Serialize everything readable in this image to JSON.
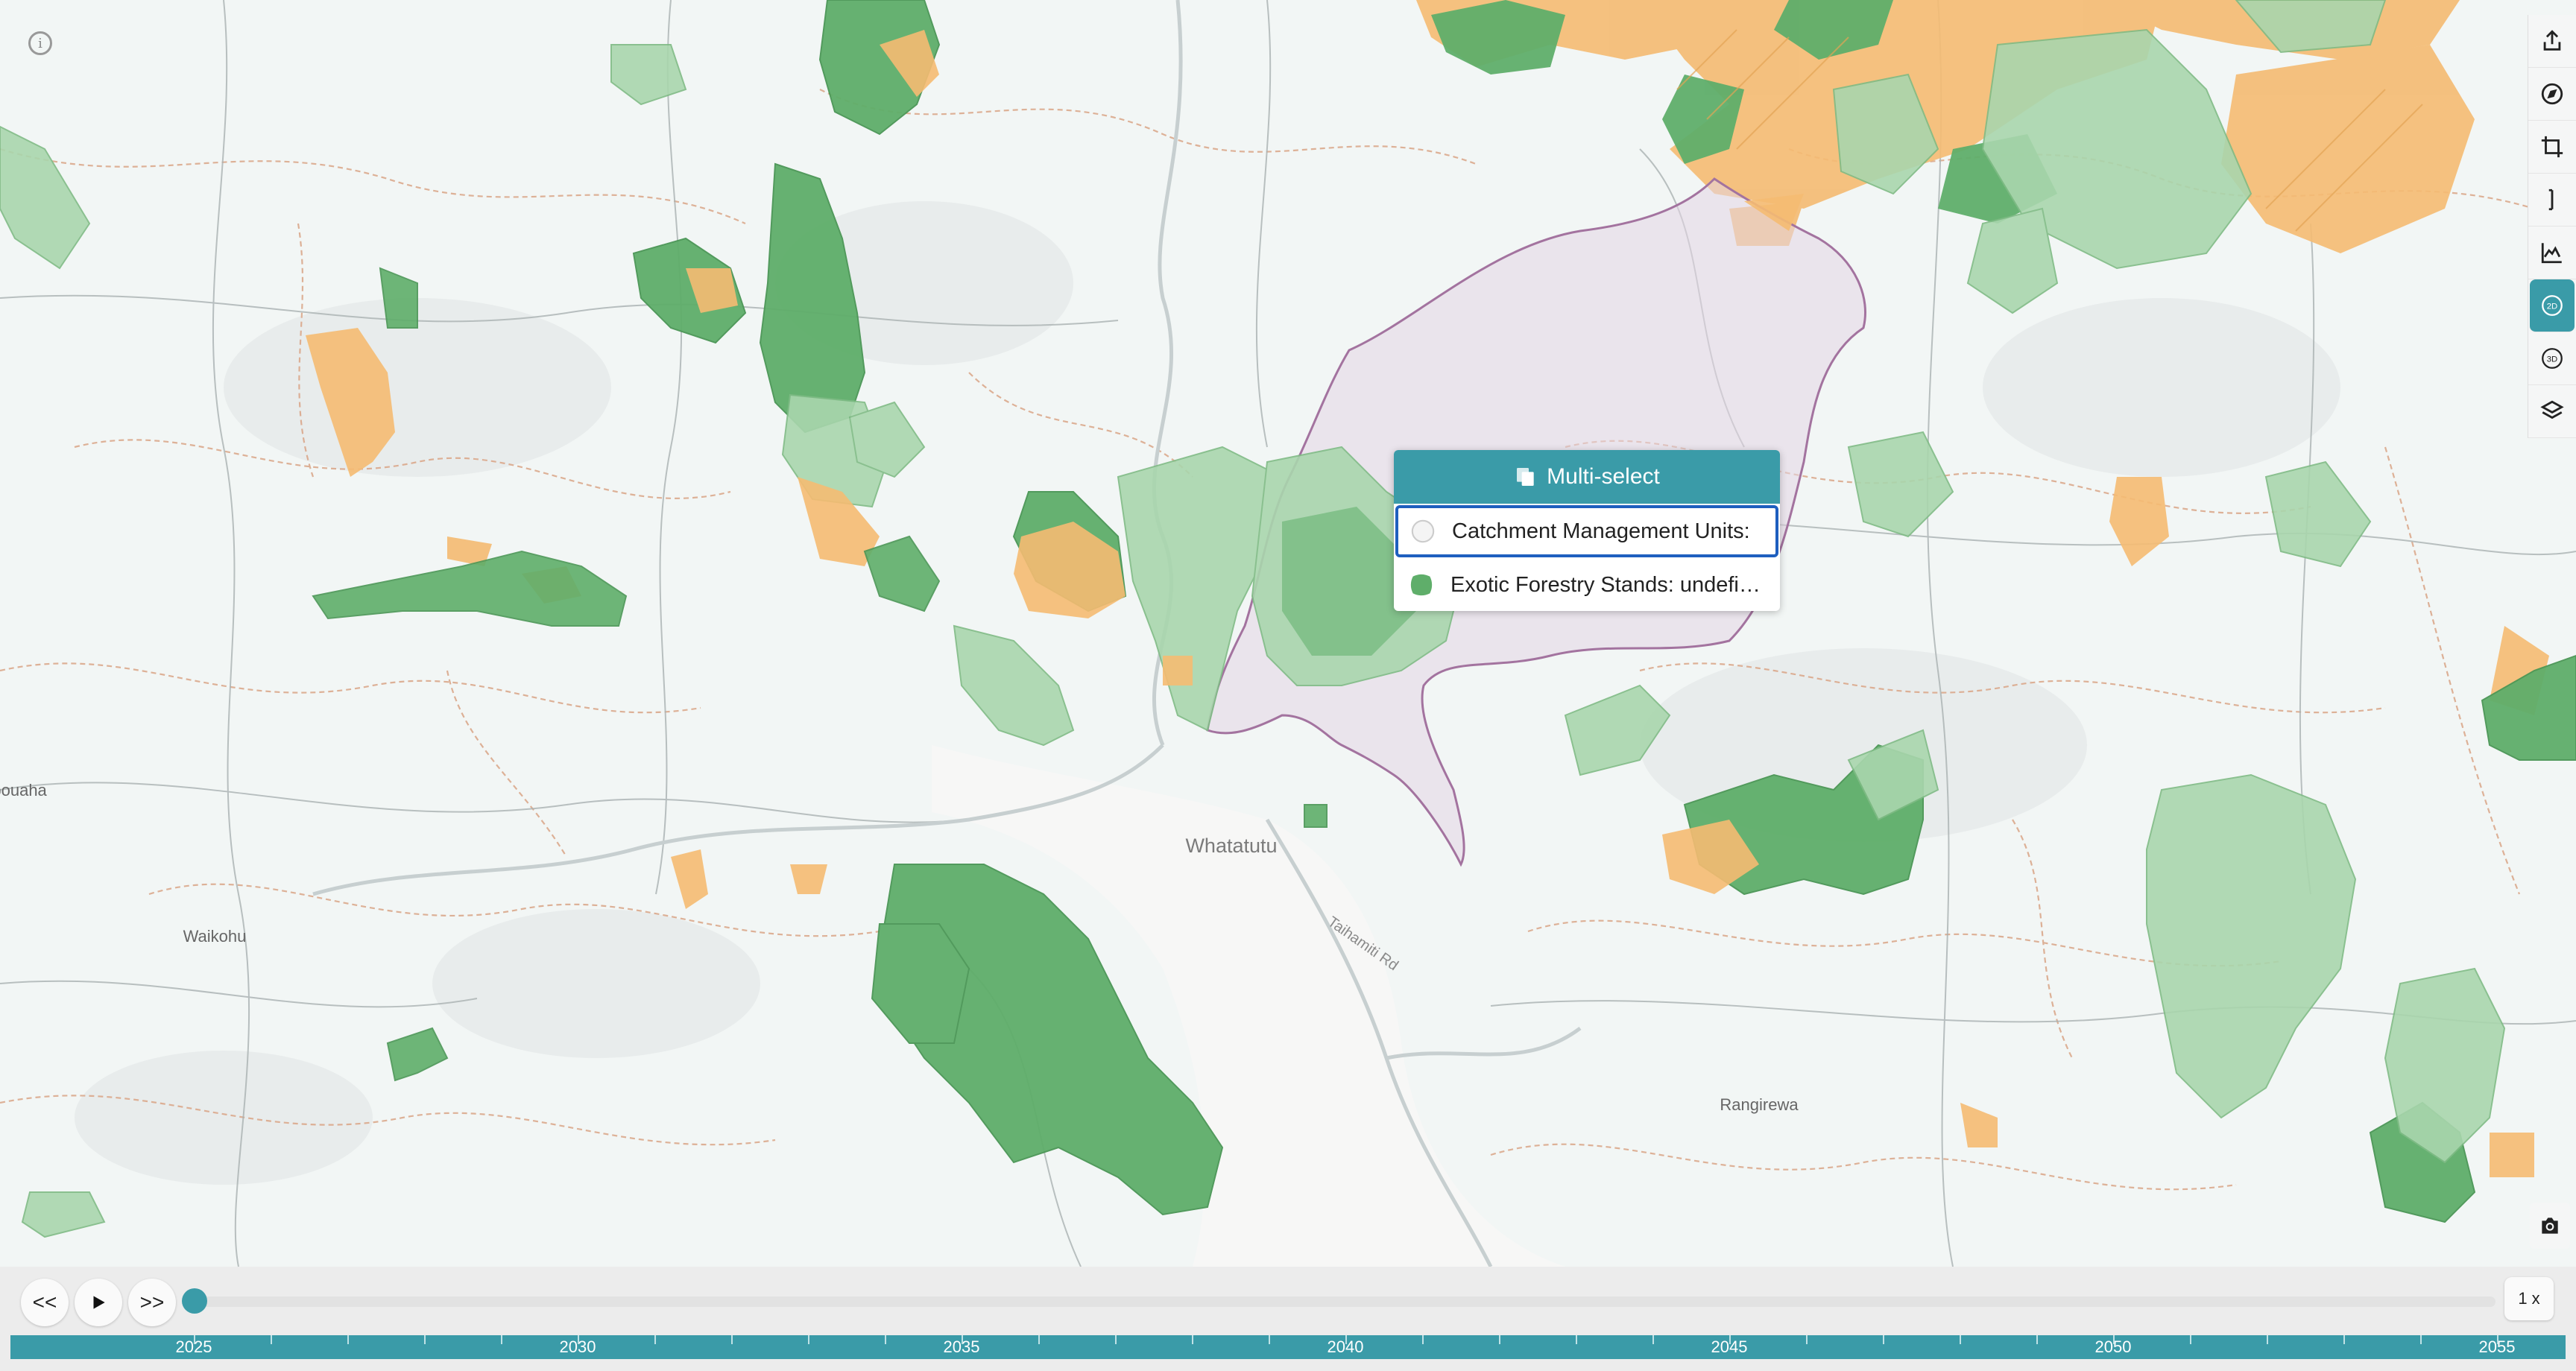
{
  "map": {
    "places": [
      "Whatatutu",
      "Taihamiti Rd",
      "Waikohu",
      "Rangirewa",
      "Puhapouaha"
    ],
    "colors": {
      "forest": "#5fae6a",
      "forest_light": "#a9d6ad",
      "harvest": "#f5bb72",
      "catchment": "#a3739f",
      "base": "#f3f6f5",
      "contour": "#d9a486",
      "teal": "#3a9ba8"
    }
  },
  "info_button": {
    "icon": "info-icon"
  },
  "toolbar": {
    "tools": [
      {
        "name": "share-icon"
      },
      {
        "name": "compass-icon"
      },
      {
        "name": "crop-icon"
      },
      {
        "name": "measure-icon"
      },
      {
        "name": "elevation-profile-icon"
      },
      {
        "name": "2d-mode-icon",
        "label": "2D"
      },
      {
        "name": "3d-mode-icon",
        "label": "3D"
      },
      {
        "name": "layers-icon"
      }
    ],
    "camera": "camera-icon"
  },
  "popup": {
    "title": "Multi-select",
    "items": [
      {
        "label": "Catchment Management Units:",
        "swatch": "empty-circle"
      },
      {
        "label": "Exotic Forestry Stands: undefi…",
        "swatch": "green-polygon"
      }
    ]
  },
  "timeline": {
    "back_label": "<<",
    "play_icon": "play-icon",
    "forward_label": ">>",
    "speed": "1 x",
    "years": [
      "2025",
      "2030",
      "2035",
      "2040",
      "2045",
      "2050",
      "2055"
    ],
    "current": "2025"
  }
}
